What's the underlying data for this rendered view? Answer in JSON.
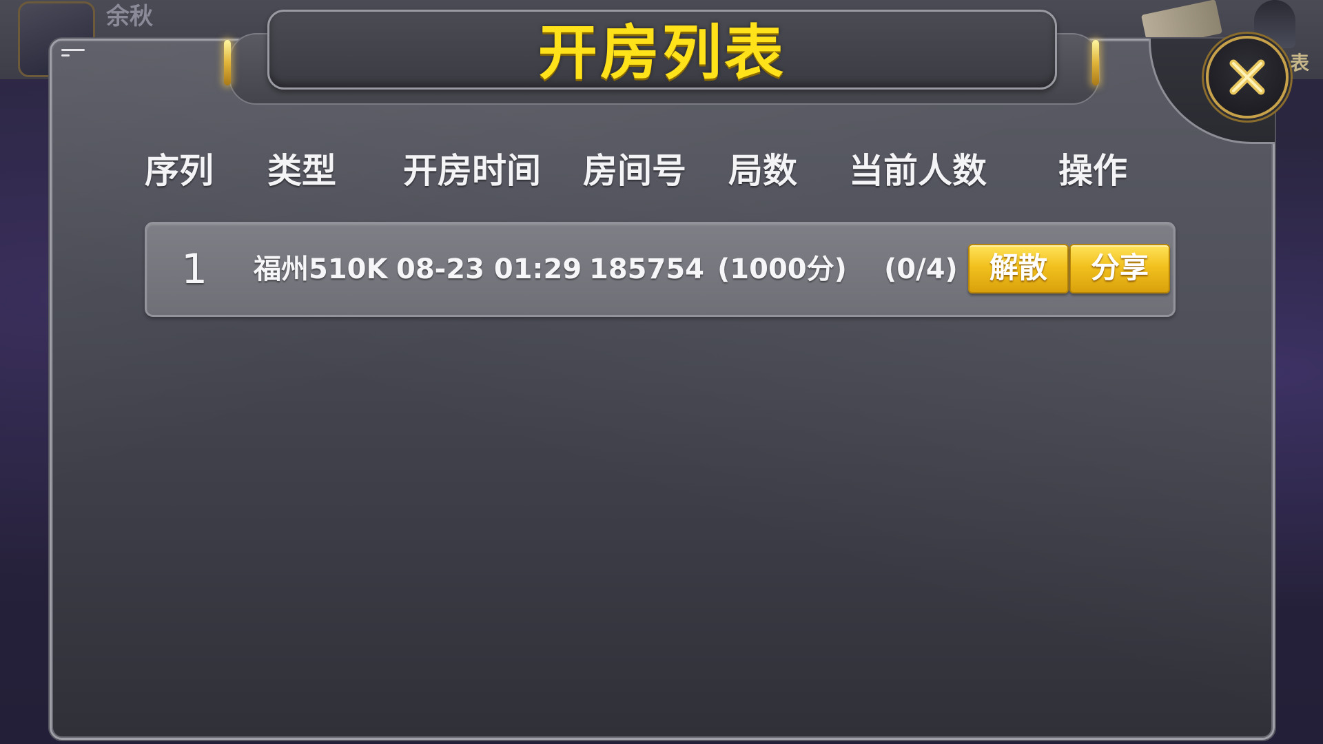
{
  "background": {
    "player_name": "余秋",
    "right_label": "表"
  },
  "dialog": {
    "title": "开房列表",
    "columns": [
      "序列",
      "类型",
      "开房时间",
      "房间号",
      "局数",
      "当前人数",
      "操作"
    ],
    "rows": [
      {
        "index": "1",
        "type": "福州510K",
        "time": "08-23 01:29",
        "room_number": "185754",
        "rounds": "(1000分)",
        "players": "(0/4)",
        "actions": {
          "dissolve": "解散",
          "share": "分享"
        }
      }
    ]
  },
  "colors": {
    "title": "#ffe21a",
    "button_gold": "#f2c11e",
    "close_ring": "#c8a24a"
  },
  "icons": {
    "close": "close-icon"
  }
}
